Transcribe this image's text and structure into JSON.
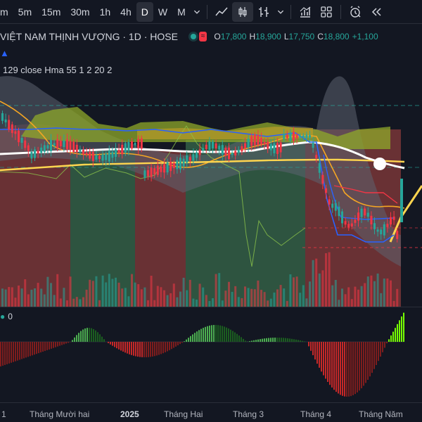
{
  "toolbar": {
    "timeframes": [
      "m",
      "5m",
      "15m",
      "30m",
      "1h",
      "4h",
      "D",
      "W",
      "M"
    ],
    "active_timeframe": "D",
    "icons": [
      "chevron-down-icon",
      "line-chart-icon",
      "candles-icon",
      "bar-chart-icon",
      "chevron-down-icon",
      "indicators-icon",
      "templates-icon",
      "alert-icon",
      "replay-icon"
    ]
  },
  "legend": {
    "symbol": "VIỆT NAM THỊNH VƯỢNG · 1D · HOSE",
    "open_key": "O",
    "open": "17,800",
    "high_key": "H",
    "high": "18,900",
    "low_key": "L",
    "low": "17,750",
    "close_key": "C",
    "close": "18,800",
    "change": "+1,100",
    "market_badge": "≈",
    "up_color": "#26a69a",
    "down_color": "#f23645"
  },
  "indicator_legend": "129 close Hma 55 1 2 20 2",
  "oscillator_legend": "0",
  "x_axis": {
    "labels": [
      "1",
      "Tháng Mười hai",
      "2025",
      "Tháng Hai",
      "Tháng 3",
      "Tháng 4",
      "Tháng Năm"
    ]
  },
  "chart_data": {
    "type": "candlestick",
    "symbol": "VIỆT NAM THỊNH VƯỢNG",
    "interval": "1D",
    "exchange": "HOSE",
    "last_bar": {
      "open": 17800,
      "high": 18900,
      "low": 17750,
      "close": 18800,
      "change": 1100
    },
    "x_axis_labels": [
      "1",
      "Tháng Mười hai",
      "2025",
      "Tháng Hai",
      "Tháng 3",
      "Tháng 4",
      "Tháng Năm"
    ],
    "grid": false,
    "indicator": "129 close Hma 55 1 2 20 2",
    "panes": [
      "price",
      "oscillator"
    ]
  }
}
